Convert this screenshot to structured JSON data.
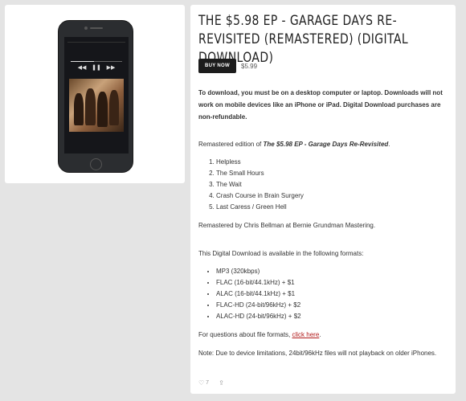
{
  "product": {
    "title": "THE $5.98 EP - GARAGE DAYS RE-REVISITED (REMASTERED) (DIGITAL DOWNLOAD)",
    "buy_label": "BUY NOW",
    "price": "$5.99",
    "notice": "To download, you must be on a desktop computer or laptop. Downloads will not work on mobile devices like an iPhone or iPad. Digital Download purchases are non-refundable.",
    "edition_prefix": "Remastered edition of ",
    "edition_title": "The $5.98 EP - Garage Days Re-Revisited",
    "edition_suffix": ".",
    "tracks": [
      "Helpless",
      "The Small Hours",
      "The Wait",
      "Crash Course in Brain Surgery",
      "Last Caress / Green Hell"
    ],
    "remastered_by": "Remastered by Chris Bellman at Bernie Grundman Mastering.",
    "formats_intro": "This Digital Download is available in the following formats:",
    "formats": [
      "MP3 (320kbps)",
      "FLAC (16-bit/44.1kHz) + $1",
      "ALAC (16-bit/44.1kHz) + $1",
      "FLAC-HD (24-bit/96kHz) + $2",
      "ALAC-HD (24-bit/96kHz) + $2"
    ],
    "questions_prefix": "For questions about file formats, ",
    "questions_link": "click here",
    "questions_suffix": ".",
    "device_note": "Note: Due to device limitations, 24bit/96kHz files will not playback on older iPhones.",
    "likes": "7"
  },
  "player": {
    "progress_fraction": 0.45
  },
  "icons": {
    "heart": "heart-icon",
    "share": "share-icon"
  }
}
